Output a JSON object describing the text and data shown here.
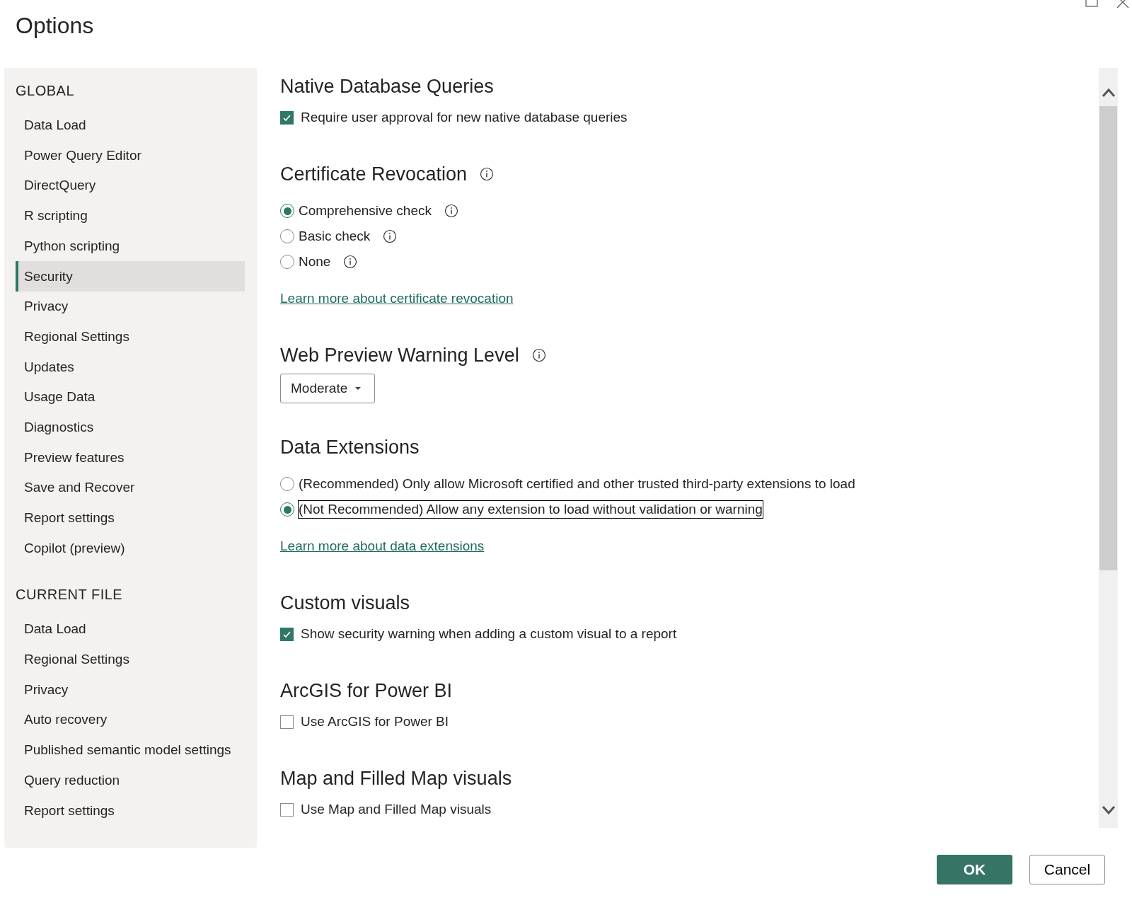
{
  "window": {
    "title": "Options"
  },
  "sidebar": {
    "sections": [
      {
        "heading": "GLOBAL",
        "items": [
          {
            "label": "Data Load",
            "selected": false
          },
          {
            "label": "Power Query Editor",
            "selected": false
          },
          {
            "label": "DirectQuery",
            "selected": false
          },
          {
            "label": "R scripting",
            "selected": false
          },
          {
            "label": "Python scripting",
            "selected": false
          },
          {
            "label": "Security",
            "selected": true
          },
          {
            "label": "Privacy",
            "selected": false
          },
          {
            "label": "Regional Settings",
            "selected": false
          },
          {
            "label": "Updates",
            "selected": false
          },
          {
            "label": "Usage Data",
            "selected": false
          },
          {
            "label": "Diagnostics",
            "selected": false
          },
          {
            "label": "Preview features",
            "selected": false
          },
          {
            "label": "Save and Recover",
            "selected": false
          },
          {
            "label": "Report settings",
            "selected": false
          },
          {
            "label": "Copilot (preview)",
            "selected": false
          }
        ]
      },
      {
        "heading": "CURRENT FILE",
        "items": [
          {
            "label": "Data Load",
            "selected": false
          },
          {
            "label": "Regional Settings",
            "selected": false
          },
          {
            "label": "Privacy",
            "selected": false
          },
          {
            "label": "Auto recovery",
            "selected": false
          },
          {
            "label": "Published semantic model settings",
            "selected": false
          },
          {
            "label": "Query reduction",
            "selected": false
          },
          {
            "label": "Report settings",
            "selected": false
          }
        ]
      }
    ]
  },
  "sections": [
    {
      "title": "Native Database Queries",
      "info": false,
      "controls": [
        {
          "kind": "checkbox",
          "label": "Require user approval for new native database queries",
          "checked": true
        }
      ]
    },
    {
      "title": "Certificate Revocation",
      "info": true,
      "controls": [
        {
          "kind": "radio",
          "label": "Comprehensive check",
          "selected": true,
          "info": true,
          "focused": false
        },
        {
          "kind": "radio",
          "label": "Basic check",
          "selected": false,
          "info": true,
          "focused": false
        },
        {
          "kind": "radio",
          "label": "None",
          "selected": false,
          "info": true,
          "focused": false
        },
        {
          "kind": "link",
          "label": "Learn more about certificate revocation"
        }
      ]
    },
    {
      "title": "Web Preview Warning Level",
      "info": true,
      "controls": [
        {
          "kind": "dropdown",
          "value": "Moderate"
        }
      ]
    },
    {
      "title": "Data Extensions",
      "info": false,
      "controls": [
        {
          "kind": "radio",
          "label": "(Recommended) Only allow Microsoft certified and other trusted third-party extensions to load",
          "selected": false,
          "info": false,
          "focused": false
        },
        {
          "kind": "radio",
          "label": "(Not Recommended) Allow any extension to load without validation or warning",
          "selected": true,
          "info": false,
          "focused": true
        },
        {
          "kind": "link",
          "label": "Learn more about data extensions"
        }
      ]
    },
    {
      "title": "Custom visuals",
      "info": false,
      "controls": [
        {
          "kind": "checkbox",
          "label": "Show security warning when adding a custom visual to a report",
          "checked": true
        }
      ]
    },
    {
      "title": "ArcGIS for Power BI",
      "info": false,
      "controls": [
        {
          "kind": "checkbox",
          "label": "Use ArcGIS for Power BI",
          "checked": false
        }
      ]
    },
    {
      "title": "Map and Filled Map visuals",
      "info": false,
      "controls": [
        {
          "kind": "checkbox",
          "label": "Use Map and Filled Map visuals",
          "checked": false
        }
      ]
    }
  ],
  "buttons": [
    {
      "label": "OK",
      "kind": "primary"
    },
    {
      "label": "Cancel",
      "kind": "secondary"
    }
  ]
}
